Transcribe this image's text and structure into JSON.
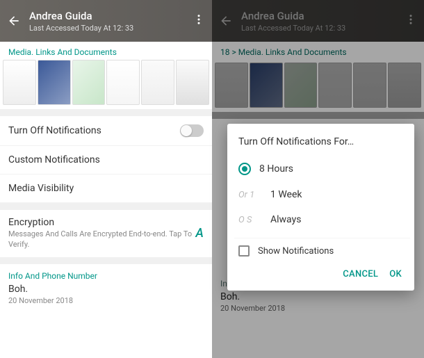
{
  "left": {
    "header": {
      "title": "Andrea Guida",
      "subtitle": "Last Accessed Today At 12: 33"
    },
    "media_section": "Media. Links And Documents",
    "rows": {
      "turn_off": "Turn Off Notifications",
      "custom": "Custom Notifications",
      "media_vis": "Media Visibility"
    },
    "encryption": {
      "title": "Encryption",
      "sub": "Messages And Calls Are Encrypted End-to-end. Tap To Verify.",
      "hint": "A"
    },
    "info": {
      "label": "Info And Phone Number",
      "value": "Boh.",
      "date": "20 November 2018"
    }
  },
  "right": {
    "header": {
      "title": "Andrea Guida",
      "subtitle": "Last Accessed Today At 12: 33"
    },
    "crumb": "18 > Media. Links And Documents",
    "info": {
      "label": "Info e numero di telefono",
      "value": "Boh.",
      "date": "20 November 2018"
    }
  },
  "dialog": {
    "title": "Turn Off Notifications For…",
    "options": [
      {
        "ghost": "",
        "label": "8 Hours",
        "selected": true
      },
      {
        "ghost": "Or 1",
        "label": "1 Week",
        "selected": false
      },
      {
        "ghost": "O S",
        "label": "Always",
        "selected": false
      }
    ],
    "checkbox": "Show Notifications",
    "cancel": "CANCEL",
    "ok": "OK"
  }
}
